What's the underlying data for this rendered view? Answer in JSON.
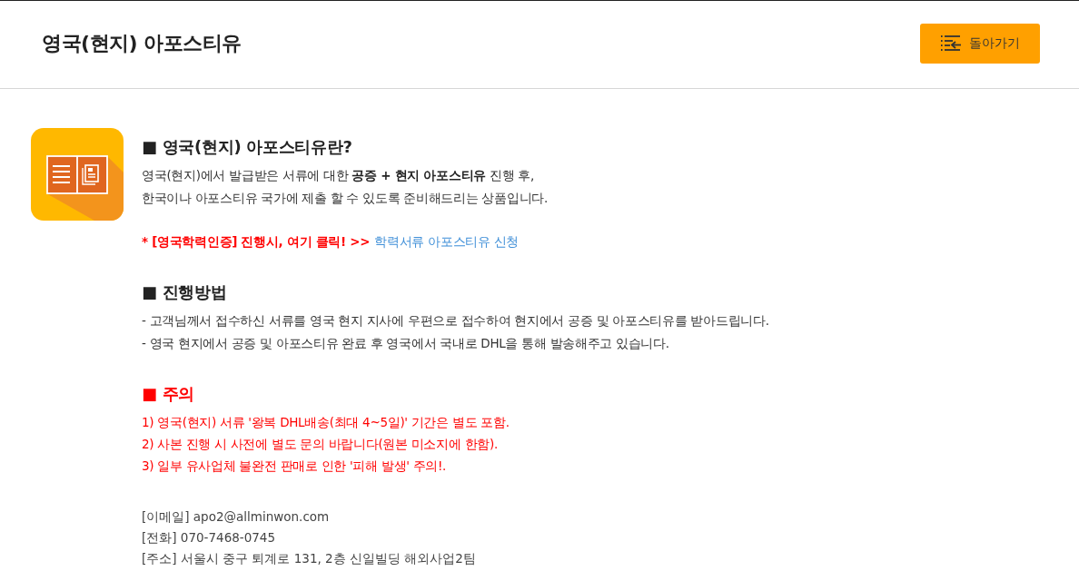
{
  "header": {
    "title": "영국(현지) 아포스티유",
    "back_button": "돌아가기"
  },
  "sections": [
    {
      "kind": "plain",
      "heading": "■ 영국(현지) 아포스티유란?",
      "lines": [
        "영국(현지)에서 발급받은 서류에 대한 **공증 + 현지 아포스티유** 진행 후,",
        "한국이나 아포스티유 국가에 제출 할 수 있도록 준비해드리는 상품입니다."
      ],
      "notice": {
        "text": "* [영국학력인증] 진행시, 여기 클릭! >>",
        "link": "학력서류 아포스티유 신청"
      }
    },
    {
      "kind": "plain",
      "heading": "■ 진행방법",
      "lines": [
        "- 고객님께서 접수하신 서류를 영국 현지 지사에 우편으로 접수하여 현지에서 공증 및 아포스티유를 받아드립니다.",
        "- 영국 현지에서 공증 및 아포스티유 완료 후 영국에서 국내로 DHL을 통해 발송해주고 있습니다."
      ]
    },
    {
      "kind": "alert",
      "heading": "■ 주의",
      "lines": [
        "1) 영국(현지) 서류 '왕복 DHL배송(최대 4~5일)' 기간은 별도 포함.",
        "2) 사본 진행 시 사전에 별도 문의 바랍니다(원본 미소지에 한함).",
        "3) 일부 유사업체 불완전 판매로 인한 '피해 발생' 주의!."
      ]
    }
  ],
  "contact": [
    "[이메일] apo2@allminwon.com",
    "[전화] 070-7468-0745",
    "[주소] 서울시 중구 퇴계로 131, 2층 신일빌딩 해외사업2팀"
  ]
}
